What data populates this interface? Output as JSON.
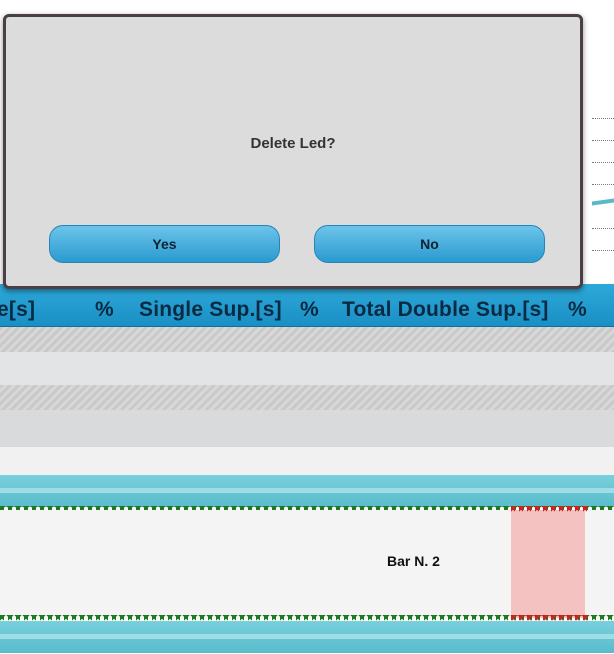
{
  "dialog": {
    "message": "Delete Led?",
    "yes_label": "Yes",
    "no_label": "No"
  },
  "table": {
    "headers": [
      "e[s]",
      "%",
      "Single Sup.[s]",
      "%",
      "Total Double Sup.[s]",
      "%"
    ]
  },
  "bar": {
    "label": "Bar N. 2"
  },
  "colors": {
    "header": "#1e9ccf",
    "teal": "#5ec0cf",
    "dialog_bg": "#dcdcdc",
    "button": "#3aa6d8",
    "highlight": "#f5c2c2",
    "tick_green": "#1f7a1f",
    "tick_red": "#d21f1f"
  }
}
